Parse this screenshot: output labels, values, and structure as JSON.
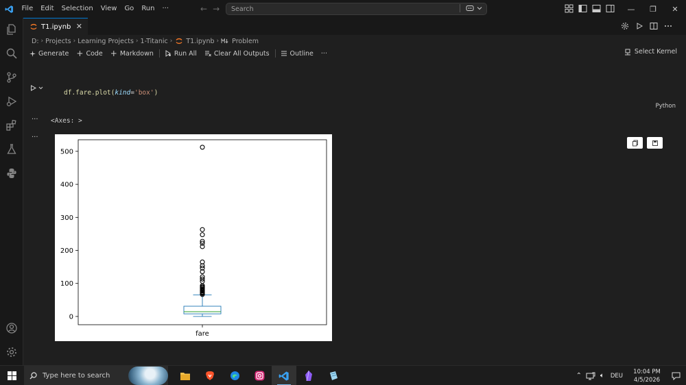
{
  "app": {
    "menu": [
      "File",
      "Edit",
      "Selection",
      "View",
      "Go",
      "Run",
      "···"
    ],
    "search_placeholder": "Search",
    "accent": "#0078d4"
  },
  "tab": {
    "title": "T1.ipynb",
    "close_glyph": "✕"
  },
  "breadcrumb": [
    "D:",
    "Projects",
    "Learning Projects",
    "1-Titanic",
    "T1.ipynb",
    "Problem"
  ],
  "toolbar": {
    "generate": "Generate",
    "code": "Code",
    "markdown": "Markdown",
    "run_all": "Run All",
    "clear_outputs": "Clear All Outputs",
    "outline": "Outline",
    "more": "···",
    "select_kernel": "Select Kernel"
  },
  "cell": {
    "code_var": "df.fare.plot(",
    "code_kw": "kind",
    "code_eq": "=",
    "code_str": "'box'",
    "code_close": ")",
    "language": "Python",
    "output_dots": "···",
    "output_text": "<Axes: >"
  },
  "chart_data": {
    "type": "box",
    "categories": [
      "fare"
    ],
    "ylim": [
      -25,
      535
    ],
    "yticks": [
      0,
      100,
      200,
      300,
      400,
      500
    ],
    "ytick_labels": [
      "0",
      "100",
      "200",
      "300",
      "400",
      "500"
    ],
    "xtick_labels": [
      "fare"
    ],
    "grid": false,
    "box": {
      "min": 0,
      "q1": 7.91,
      "median": 14.45,
      "q3": 31,
      "whisker_high": 65
    },
    "outliers": [
      512.33,
      263,
      247.5,
      227.5,
      221.8,
      211.5,
      164.9,
      153.5,
      146.5,
      135.6,
      120,
      113.3,
      106.4,
      93.5,
      90,
      89.1,
      86.5,
      83.2,
      80,
      78.3,
      76.7,
      73.5,
      71.3,
      69.6,
      66.6
    ],
    "colors": {
      "box": "#1f77b4",
      "median": "#2ca02c",
      "outlier": "#000000"
    }
  },
  "taskbar": {
    "search_placeholder": "Type here to search",
    "time": "10:04 PM",
    "date": "4/5/2026",
    "lang": "DEU"
  }
}
